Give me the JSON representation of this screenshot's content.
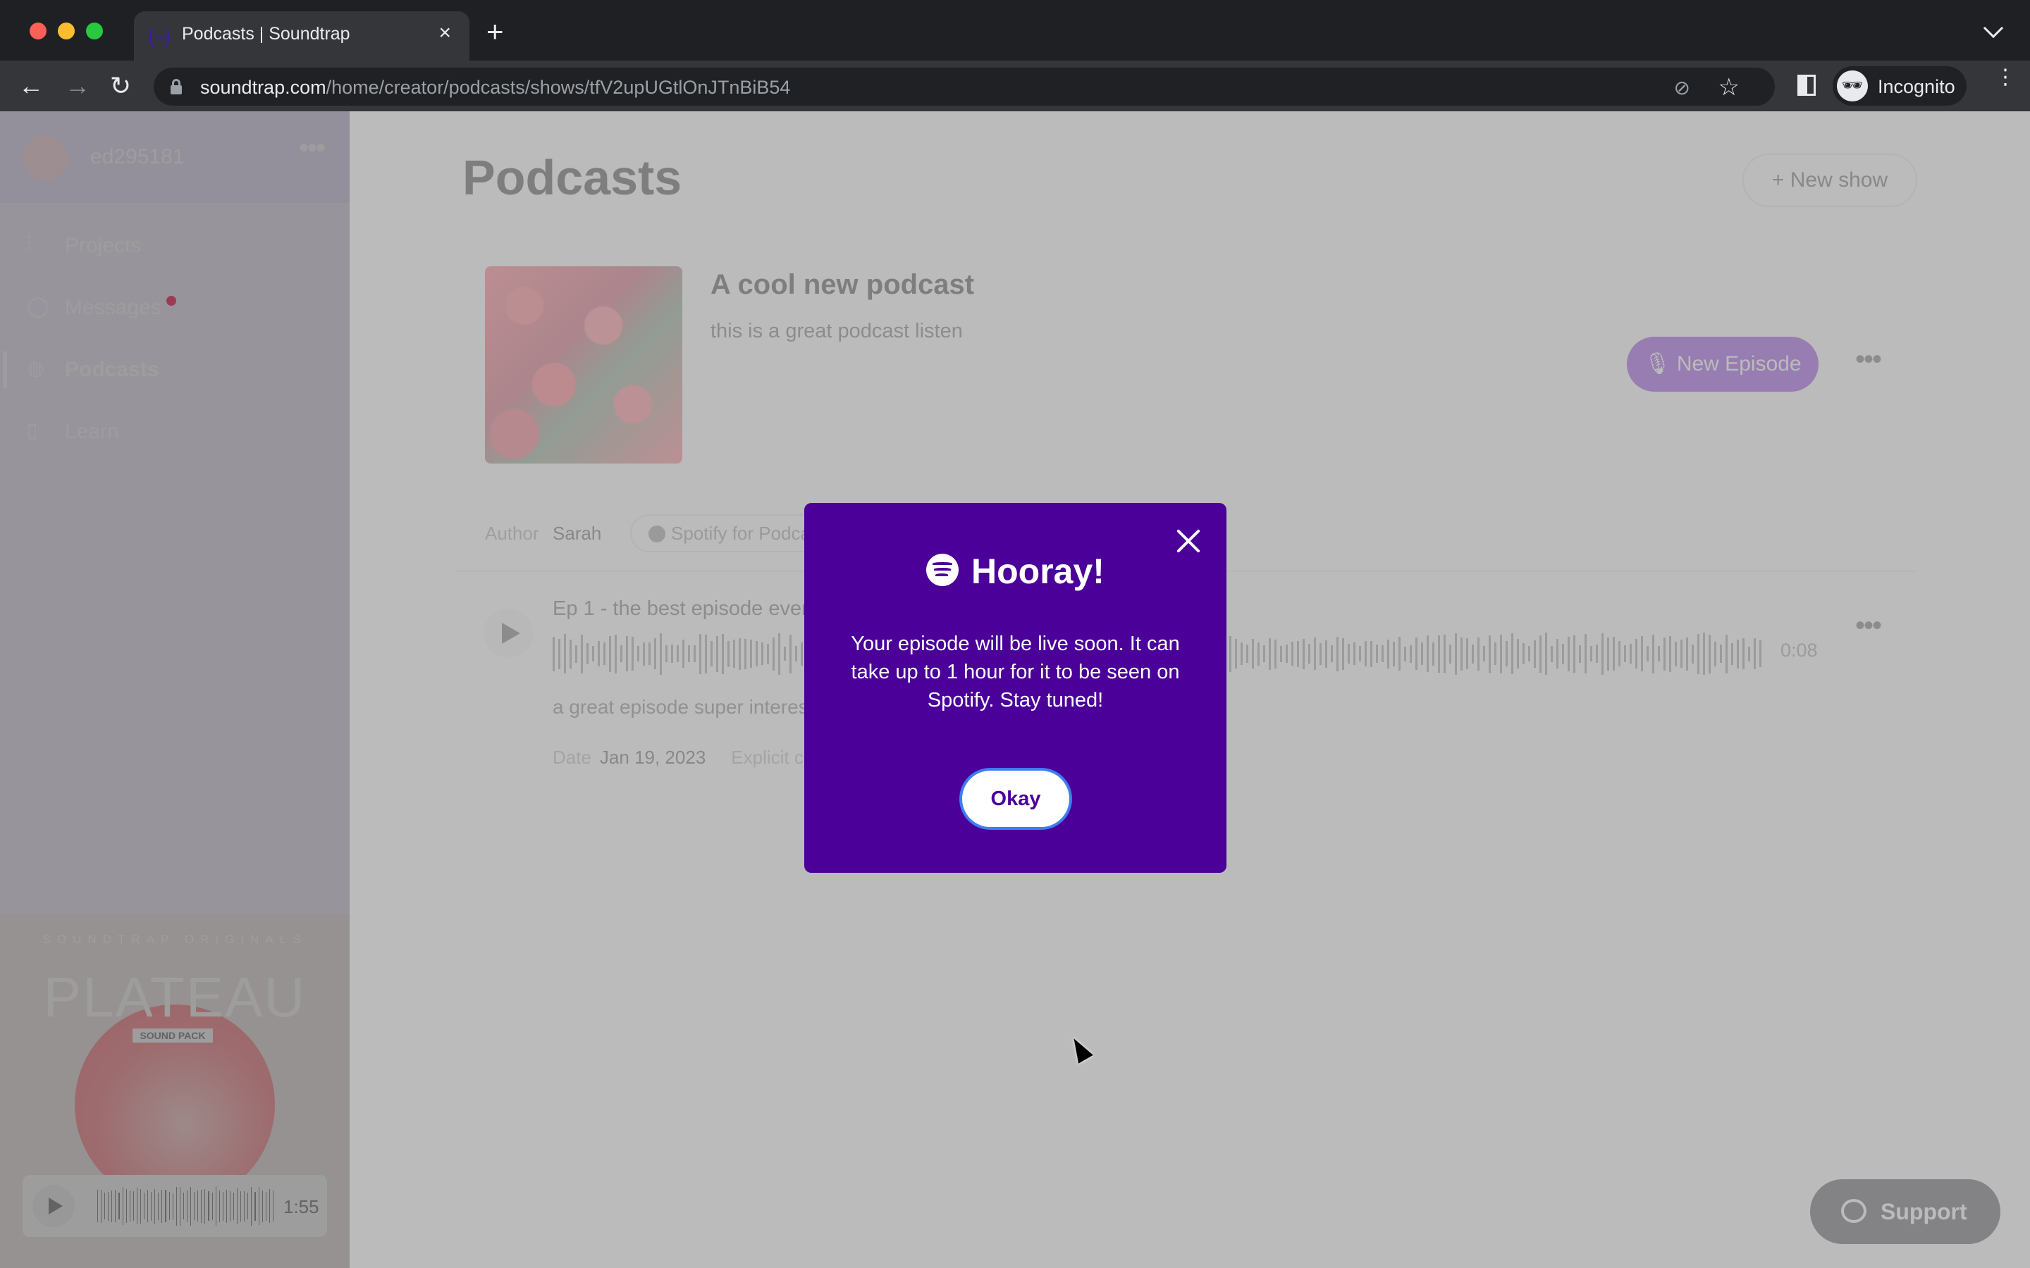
{
  "browser": {
    "tab_title": "Podcasts | Soundtrap",
    "tab_favicon": "soundtrap-logo-icon",
    "url_host": "soundtrap.com",
    "url_path": "/home/creator/podcasts/shows/tfV2upUGtlOnJTnBiB54",
    "profile_label": "Incognito"
  },
  "sidebar": {
    "username": "ed295181",
    "items": [
      {
        "label": "Projects",
        "icon": "waveform-icon",
        "active": false
      },
      {
        "label": "Messages",
        "icon": "chat-bubble-icon",
        "active": false,
        "badge": true
      },
      {
        "label": "Podcasts",
        "icon": "globe-icon",
        "active": true
      },
      {
        "label": "Learn",
        "icon": "book-icon",
        "active": false
      }
    ],
    "promo": {
      "kicker": "SOUNDTRAP ORIGINALS",
      "title": "PLATEAU",
      "subtitle": "SOUND PACK",
      "duration": "1:55"
    }
  },
  "main": {
    "page_title": "Podcasts",
    "new_show_label": "New show",
    "show": {
      "title": "A cool new podcast",
      "description": "this is a great podcast listen",
      "new_episode_label": "New Episode",
      "author_label": "Author",
      "author": "Sarah",
      "distribution_chip": "Spotify for Podcasters"
    },
    "episodes": [
      {
        "title": "Ep 1 - the best episode ever",
        "description": "a great episode super interesting",
        "duration": "0:08",
        "date_label": "Date",
        "date": "Jan 19, 2023",
        "explicit_label": "Explicit content"
      }
    ],
    "support_label": "Support"
  },
  "modal": {
    "heading": "Hooray!",
    "body": "Your episode will be live soon. It can take up to 1 hour for it to be seen on Spotify. Stay tuned!",
    "okay_label": "Okay"
  },
  "colors": {
    "modal_bg": "#4a0099",
    "accent": "#7b1fd8",
    "focus_ring": "#3f7cf2"
  }
}
